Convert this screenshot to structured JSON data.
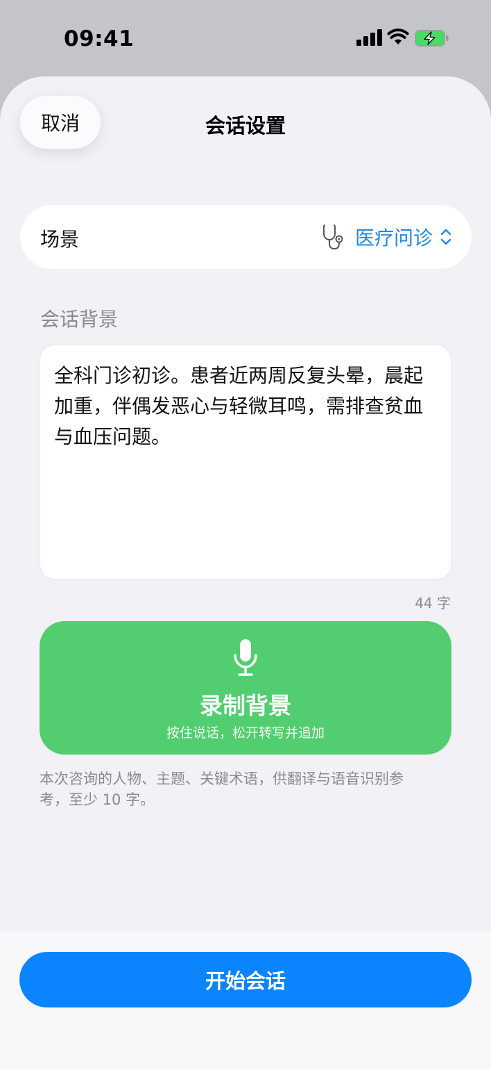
{
  "status_bar": {
    "time": "09:41",
    "icons": [
      "cellular-signal-icon",
      "wifi-icon",
      "battery-charging-icon"
    ]
  },
  "header": {
    "cancel_label": "取消",
    "title": "会话设置"
  },
  "scene": {
    "label": "场景",
    "icon": "stethoscope-icon",
    "value": "医疗问诊"
  },
  "context": {
    "section_label": "会话背景",
    "text": "全科门诊初诊。患者近两周反复头晕，晨起加重，伴偶发恶心与轻微耳鸣，需排查贫血与血压问题。",
    "char_count": "44 字"
  },
  "record": {
    "icon": "microphone-icon",
    "title": "录制背景",
    "hint": "按住说话，松开转写并追加"
  },
  "footnote": "本次咨询的人物、主题、关键术语，供翻译与语音识别参考，至少 10 字。",
  "footer": {
    "start_label": "开始会话"
  },
  "colors": {
    "accent_blue": "#0a84ff",
    "link_blue": "#1f88e5",
    "record_green": "#52cd70",
    "battery_green": "#4cd964"
  }
}
